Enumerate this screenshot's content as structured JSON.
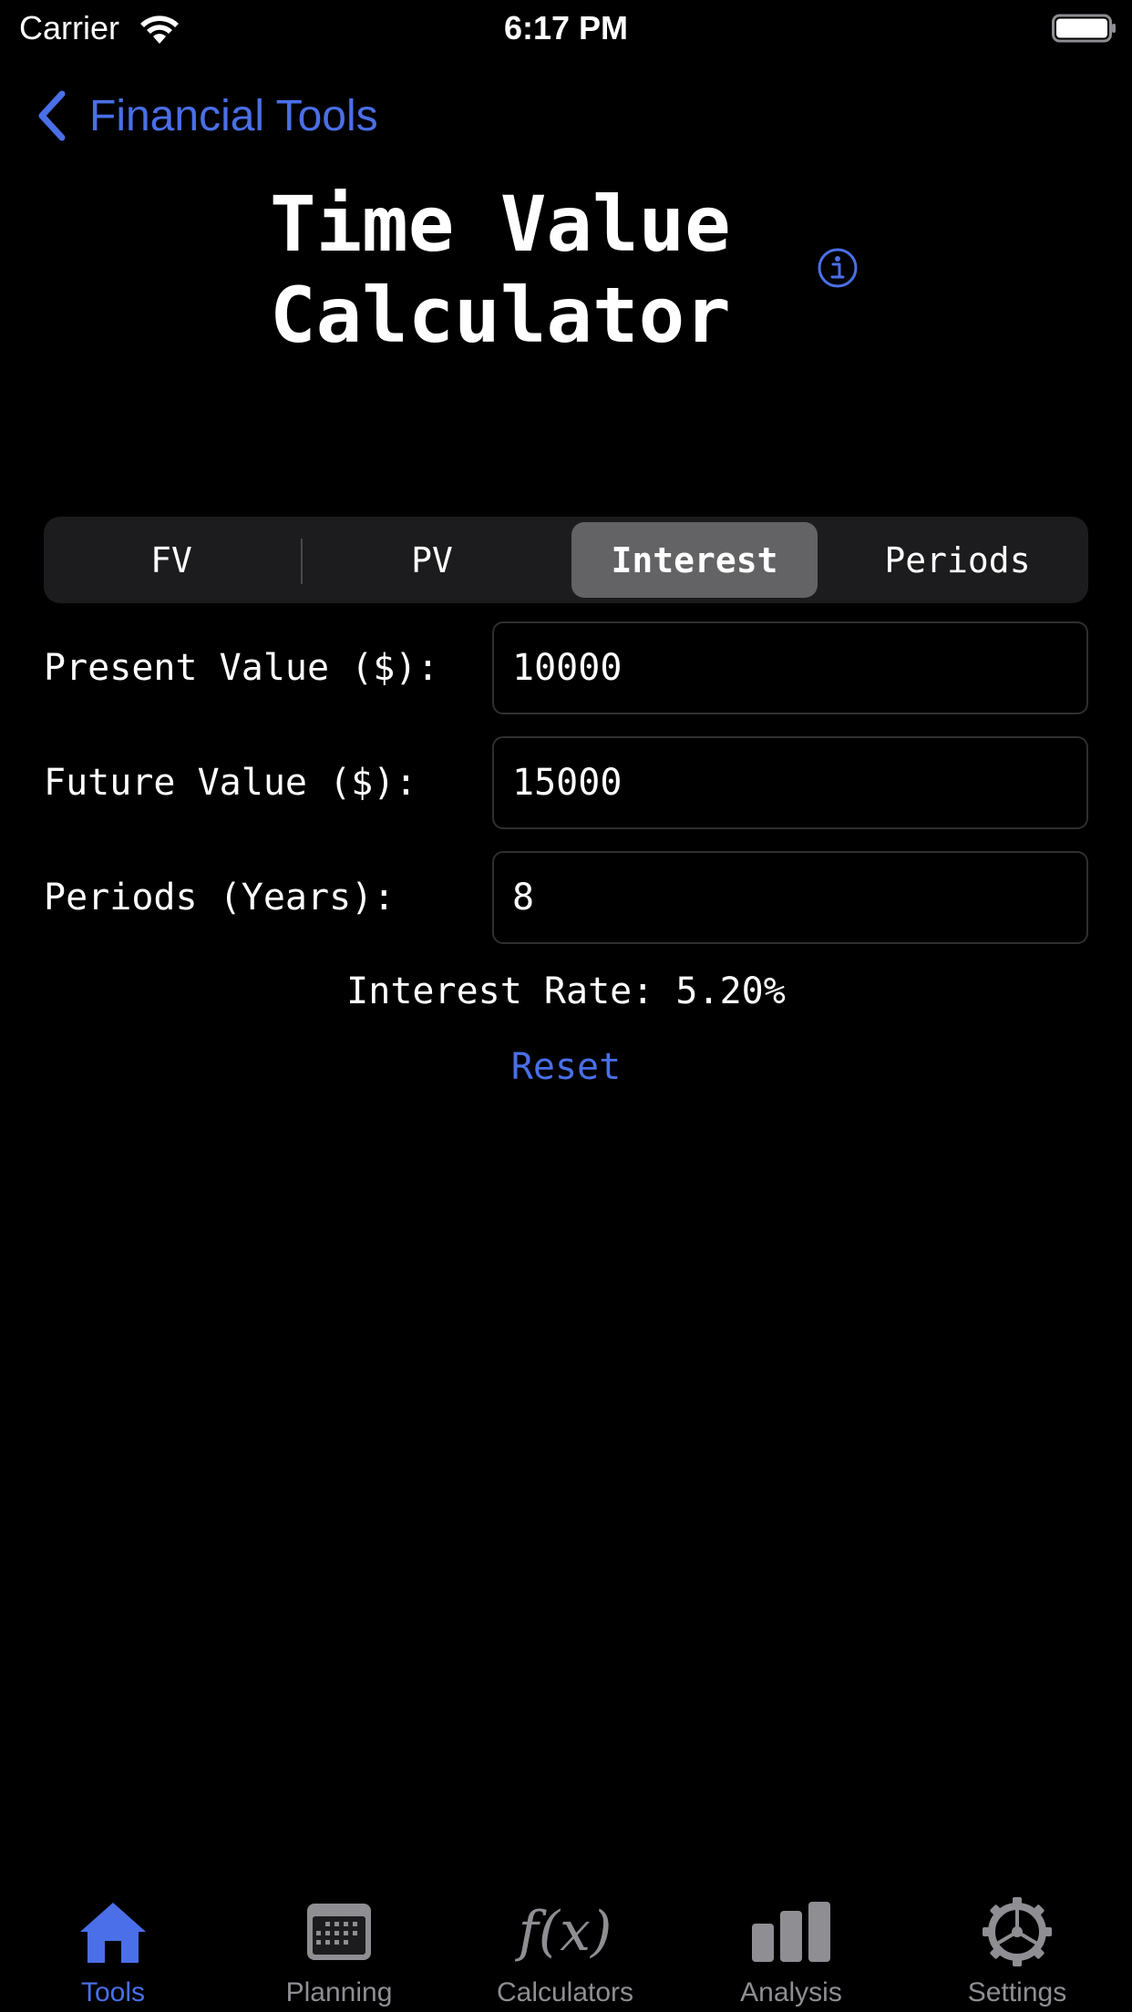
{
  "status_bar": {
    "carrier": "Carrier",
    "time": "6:17 PM"
  },
  "nav": {
    "back_label": "Financial Tools"
  },
  "title": "Time Value Calculator",
  "segments": [
    {
      "label": "FV",
      "active": false
    },
    {
      "label": "PV",
      "active": false
    },
    {
      "label": "Interest",
      "active": true
    },
    {
      "label": "Periods",
      "active": false
    }
  ],
  "form": {
    "present_value": {
      "label": "Present Value ($):",
      "value": "10000"
    },
    "future_value": {
      "label": "Future Value ($):",
      "value": "15000"
    },
    "periods": {
      "label": "Periods (Years):",
      "value": "8"
    }
  },
  "result": "Interest Rate: 5.20%",
  "reset_label": "Reset",
  "tabbar": {
    "tools": "Tools",
    "planning": "Planning",
    "calculators": "Calculators",
    "calculators_glyph": "f(x)",
    "analysis": "Analysis",
    "settings": "Settings"
  },
  "colors": {
    "accent": "#4a6fe8",
    "background": "#000000",
    "inactive": "#8e8e93",
    "segment_bg": "#1c1c1e",
    "segment_active": "#636366"
  }
}
